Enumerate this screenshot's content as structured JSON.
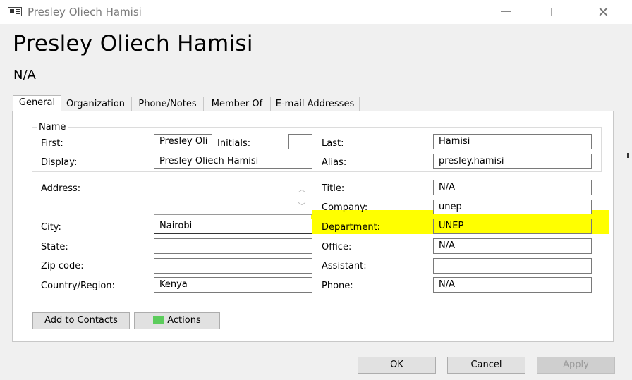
{
  "window": {
    "title": "Presley Oliech Hamisi",
    "minimize_glyph": "—",
    "maximize_glyph": "☐",
    "close_glyph": "✕",
    "icon": "contact-card-icon"
  },
  "header": {
    "display_name": "Presley Oliech Hamisi",
    "title": "N/A"
  },
  "tabs": [
    {
      "label": "General",
      "active": true
    },
    {
      "label": "Organization",
      "active": false
    },
    {
      "label": "Phone/Notes",
      "active": false
    },
    {
      "label": "Member Of",
      "active": false
    },
    {
      "label": "E-mail Addresses",
      "active": false
    }
  ],
  "name_group": {
    "label": "Name",
    "first_label": "First:",
    "first_value": "Presley Oli",
    "initials_label": "Initials:",
    "initials_value": "",
    "last_label": "Last:",
    "last_value": "Hamisi",
    "display_label": "Display:",
    "display_value": "Presley Oliech Hamisi",
    "alias_label": "Alias:",
    "alias_value": "presley.hamisi"
  },
  "address": {
    "address_label": "Address:",
    "address_value": "",
    "city_label": "City:",
    "city_value": "Nairobi",
    "state_label": "State:",
    "state_value": "",
    "zip_label": "Zip code:",
    "zip_value": "",
    "country_label": "Country/Region:",
    "country_value": "Kenya"
  },
  "work": {
    "title_label": "Title:",
    "title_value": "N/A",
    "company_label": "Company:",
    "company_value": "unep",
    "department_label": "Department:",
    "department_value": "UNEP",
    "office_label": "Office:",
    "office_value": "N/A",
    "assistant_label": "Assistant:",
    "assistant_value": "",
    "phone_label": "Phone:",
    "phone_value": "N/A"
  },
  "buttons": {
    "add_to_contacts": "Add to Contacts",
    "actions_pre": "Actio",
    "actions_u": "n",
    "actions_post": "s",
    "ok": "OK",
    "cancel": "Cancel",
    "apply": "Apply"
  },
  "colors": {
    "highlight": "#ffff00",
    "actions_icon": "#5ccc5c"
  }
}
